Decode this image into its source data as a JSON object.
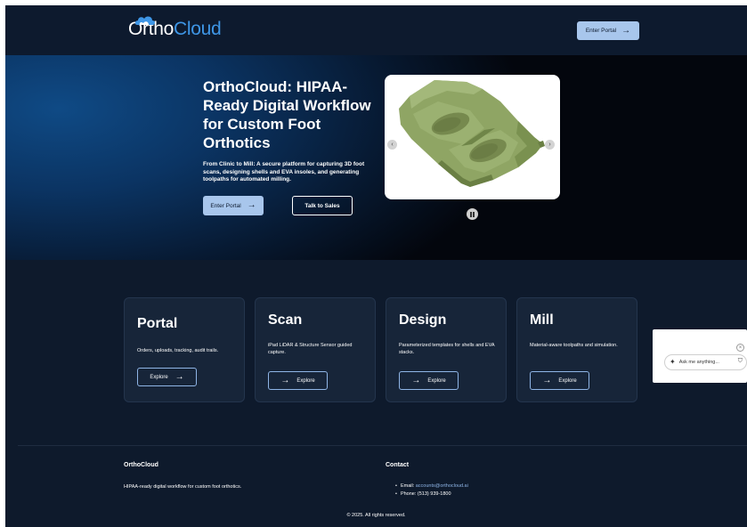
{
  "header": {
    "logo": {
      "part1": "Ortho",
      "part2": "Cloud"
    },
    "enter_portal_label": "Enter Portal"
  },
  "hero": {
    "title": "OrthoCloud: HIPAA-Ready Digital Workflow for Custom Foot Orthotics",
    "subtitle": "From Clinic to Mill: A secure platform for capturing 3D foot scans, designing shells and EVA insoles, and generating toolpaths for automated milling.",
    "enter_portal_label": "Enter Portal",
    "talk_to_sales_label": "Talk to Sales",
    "carousel": {
      "prev_glyph": "‹",
      "next_glyph": "›"
    }
  },
  "features": [
    {
      "title": "Portal",
      "description": "Orders, uploads, tracking, audit trails.",
      "button": "Explore"
    },
    {
      "title": "Scan",
      "description": "iPad LiDAR & Structure Sensor guided capture.",
      "button": "Explore"
    },
    {
      "title": "Design",
      "description": "Parameterized templates for shells and EVA stacks.",
      "button": "Explore"
    },
    {
      "title": "Mill",
      "description": "Material-aware toolpaths and simulation.",
      "button": "Explore"
    }
  ],
  "footer": {
    "brand": "OrthoCloud",
    "description": "HIPAA-ready digital workflow for custom foot orthotics.",
    "contact_heading": "Contact",
    "email_label": "Email: ",
    "email": "accounts@orthocloud.ai",
    "phone": "Phone: (513) 939-1800",
    "copyright": "© 2025. All rights reserved."
  },
  "chat": {
    "placeholder": "Ask me anything...",
    "close_glyph": "×"
  },
  "colors": {
    "background": "#0e1a2c",
    "accent": "#3e96e6",
    "button_light": "#a8c6ec",
    "card": "#172539",
    "model_green": "#8fa564"
  },
  "icons": {
    "arrow": "arrow-right-icon",
    "spark": "sparkle-icon",
    "shield": "shield-icon"
  }
}
